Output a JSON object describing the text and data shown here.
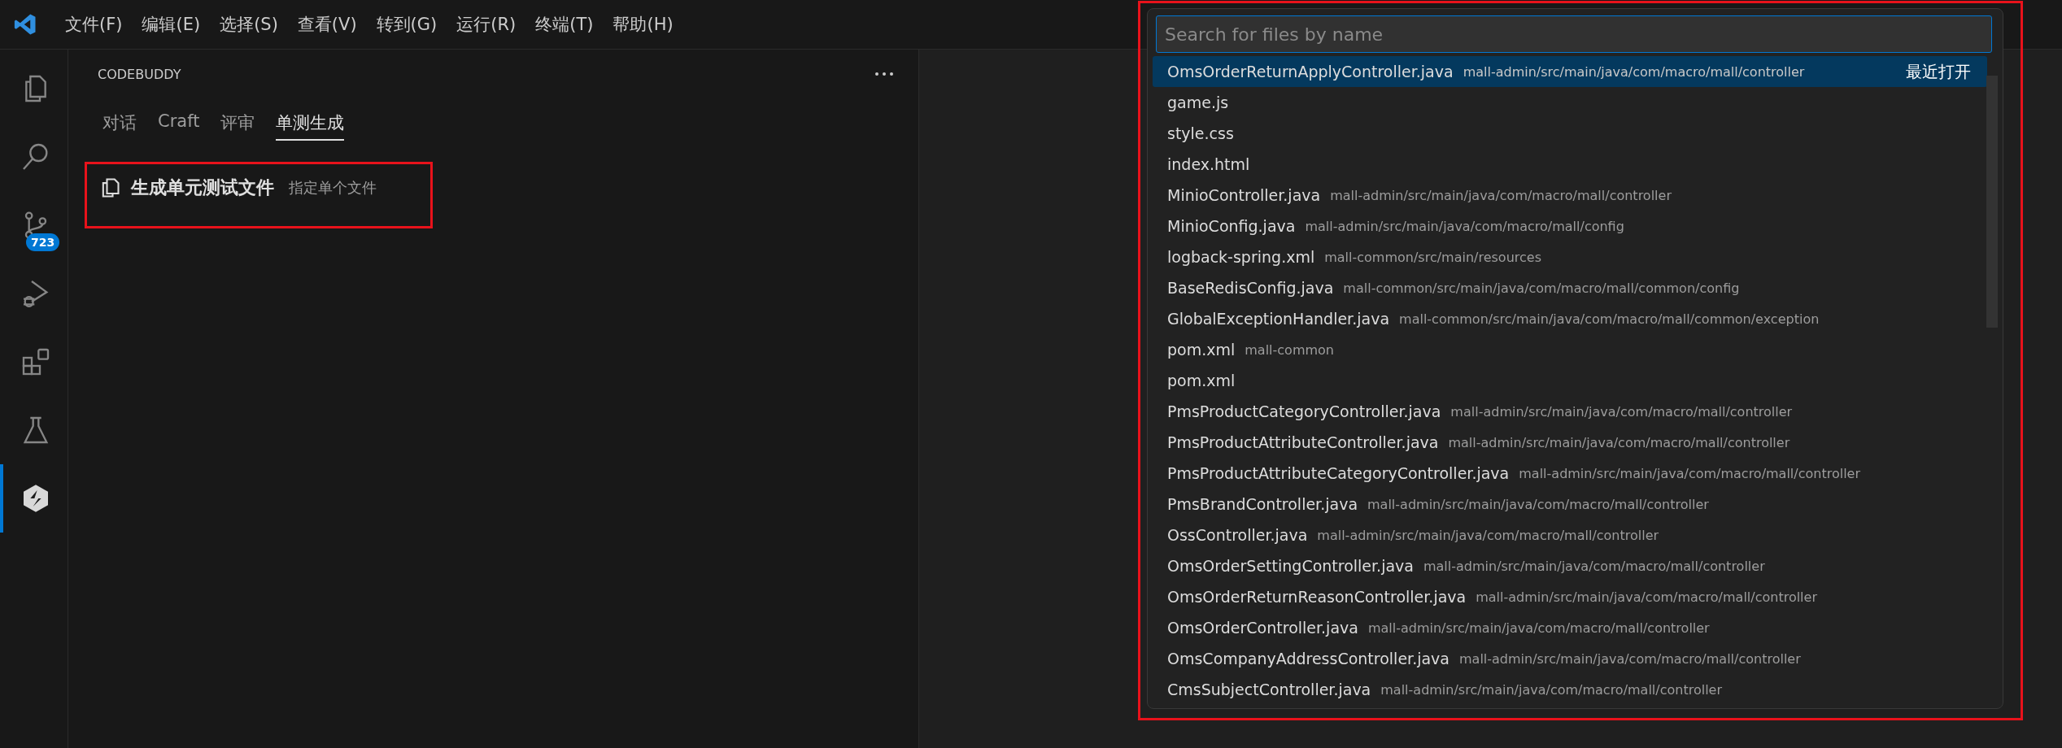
{
  "menu_bar": {
    "items": [
      "文件(F)",
      "编辑(E)",
      "选择(S)",
      "查看(V)",
      "转到(G)",
      "运行(R)",
      "终端(T)",
      "帮助(H)"
    ]
  },
  "activity_bar": {
    "items": [
      {
        "kind": "files",
        "selected": false
      },
      {
        "kind": "search",
        "selected": false
      },
      {
        "kind": "source-control",
        "selected": false,
        "badge": "723"
      },
      {
        "kind": "run-debug",
        "selected": false
      },
      {
        "kind": "extensions",
        "selected": false
      },
      {
        "kind": "testing",
        "selected": false
      },
      {
        "kind": "codebuddy",
        "selected": true
      }
    ]
  },
  "sidebar": {
    "title": "CODEBUDDY",
    "tabs": [
      {
        "label": "对话",
        "selected": false
      },
      {
        "label": "Craft",
        "selected": false
      },
      {
        "label": "评审",
        "selected": false
      },
      {
        "label": "单测生成",
        "selected": true
      }
    ],
    "action": {
      "title": "生成单元测试文件",
      "description": "指定单个文件"
    }
  },
  "quick_open": {
    "placeholder": "Search for files by name",
    "results": [
      {
        "name": "OmsOrderReturnApplyController.java",
        "path": "mall-admin/src/main/java/com/macro/mall/controller",
        "tag": "最近打开",
        "selected": true
      },
      {
        "name": "game.js",
        "selected": false
      },
      {
        "name": "style.css",
        "selected": false
      },
      {
        "name": "index.html",
        "selected": false
      },
      {
        "name": "MinioController.java",
        "path": "mall-admin/src/main/java/com/macro/mall/controller",
        "selected": false
      },
      {
        "name": "MinioConfig.java",
        "path": "mall-admin/src/main/java/com/macro/mall/config",
        "selected": false
      },
      {
        "name": "logback-spring.xml",
        "path": "mall-common/src/main/resources",
        "selected": false
      },
      {
        "name": "BaseRedisConfig.java",
        "path": "mall-common/src/main/java/com/macro/mall/common/config",
        "selected": false
      },
      {
        "name": "GlobalExceptionHandler.java",
        "path": "mall-common/src/main/java/com/macro/mall/common/exception",
        "selected": false
      },
      {
        "name": "pom.xml",
        "path": "mall-common",
        "selected": false
      },
      {
        "name": "pom.xml",
        "selected": false
      },
      {
        "name": "PmsProductCategoryController.java",
        "path": "mall-admin/src/main/java/com/macro/mall/controller",
        "selected": false
      },
      {
        "name": "PmsProductAttributeController.java",
        "path": "mall-admin/src/main/java/com/macro/mall/controller",
        "selected": false
      },
      {
        "name": "PmsProductAttributeCategoryController.java",
        "path": "mall-admin/src/main/java/com/macro/mall/controller",
        "selected": false
      },
      {
        "name": "PmsBrandController.java",
        "path": "mall-admin/src/main/java/com/macro/mall/controller",
        "selected": false
      },
      {
        "name": "OssController.java",
        "path": "mall-admin/src/main/java/com/macro/mall/controller",
        "selected": false
      },
      {
        "name": "OmsOrderSettingController.java",
        "path": "mall-admin/src/main/java/com/macro/mall/controller",
        "selected": false
      },
      {
        "name": "OmsOrderReturnReasonController.java",
        "path": "mall-admin/src/main/java/com/macro/mall/controller",
        "selected": false
      },
      {
        "name": "OmsOrderController.java",
        "path": "mall-admin/src/main/java/com/macro/mall/controller",
        "selected": false
      },
      {
        "name": "OmsCompanyAddressController.java",
        "path": "mall-admin/src/main/java/com/macro/mall/controller",
        "selected": false
      },
      {
        "name": "CmsSubjectController.java",
        "path": "mall-admin/src/main/java/com/macro/mall/controller",
        "selected": false
      }
    ]
  }
}
